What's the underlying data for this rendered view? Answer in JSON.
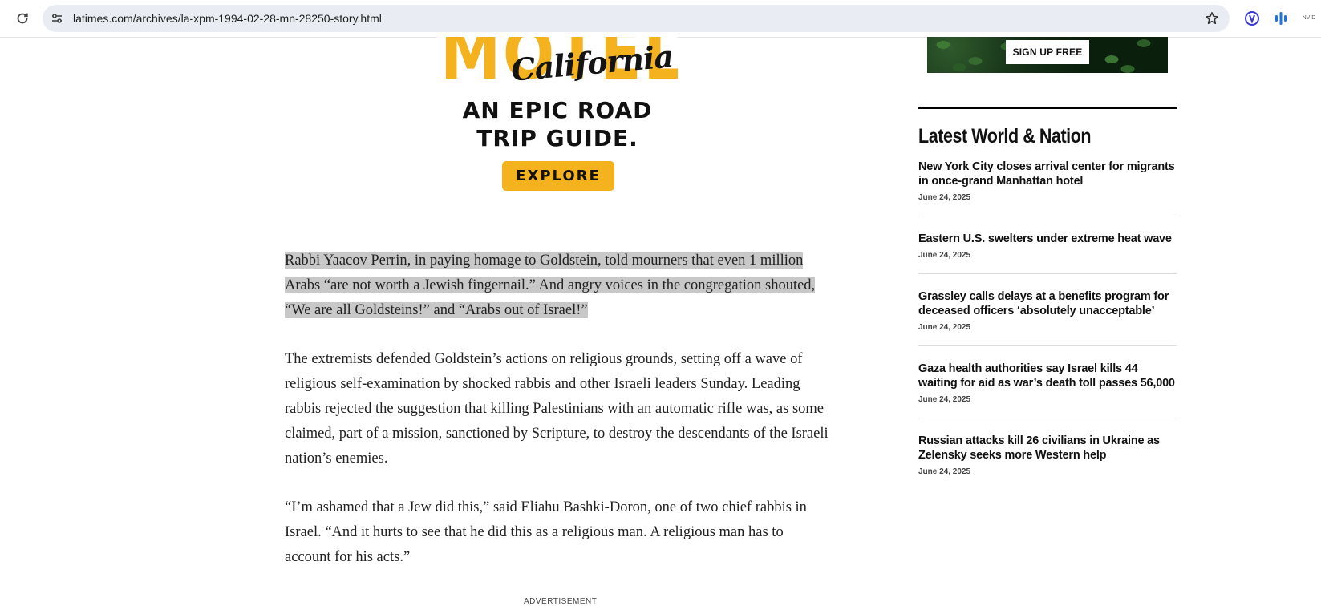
{
  "browser": {
    "url": "latimes.com/archives/la-xpm-1994-02-28-mn-28250-story.html",
    "ext3_label": "NVID"
  },
  "ad": {
    "brand_word": "MOTEL",
    "script_word": "California",
    "headline_line1": "AN EPIC ROAD",
    "headline_line2": "TRIP GUIDE.",
    "cta": "EXPLORE",
    "brand_color": "#f5b21f"
  },
  "article": {
    "paragraphs": [
      "Rabbi Yaacov Perrin, in paying homage to Goldstein, told mourners that even 1 million Arabs “are not worth a Jewish fingernail.” And angry voices in the congregation shouted, “We are all Goldsteins!” and “Arabs out of Israel!”",
      "The extremists defended Goldstein’s actions on religious grounds, setting off a wave of religious self-examination by shocked rabbis and other Israeli leaders Sunday. Leading rabbis rejected the suggestion that killing Palestinians with an automatic rifle was, as some claimed, part of a mission, sanctioned by Scripture, to destroy the descendants of the Israeli nation’s enemies.",
      "“I’m ashamed that a Jew did this,” said Eliahu Bashki-Doron, one of two chief rabbis in Israel. “And it hurts to see that he did this as a religious man. A religious man has to account for his acts.”"
    ],
    "advertisement_label": "ADVERTISEMENT"
  },
  "sidebar": {
    "signup_label": "SIGN UP FREE",
    "latest_title": "Latest World & Nation",
    "stories": [
      {
        "headline": "New York City closes arrival center for migrants in once-grand Manhattan hotel",
        "date": "June 24, 2025"
      },
      {
        "headline": "Eastern U.S. swelters under extreme heat wave",
        "date": "June 24, 2025"
      },
      {
        "headline": "Grassley calls delays at a benefits program for deceased officers ‘absolutely unacceptable’",
        "date": "June 24, 2025"
      },
      {
        "headline": "Gaza health authorities say Israel kills 44 waiting for aid as war’s death toll passes 56,000",
        "date": "June 24, 2025"
      },
      {
        "headline": "Russian attacks kill 26 civilians in Ukraine as Zelensky seeks more Western help",
        "date": "June 24, 2025"
      }
    ]
  }
}
